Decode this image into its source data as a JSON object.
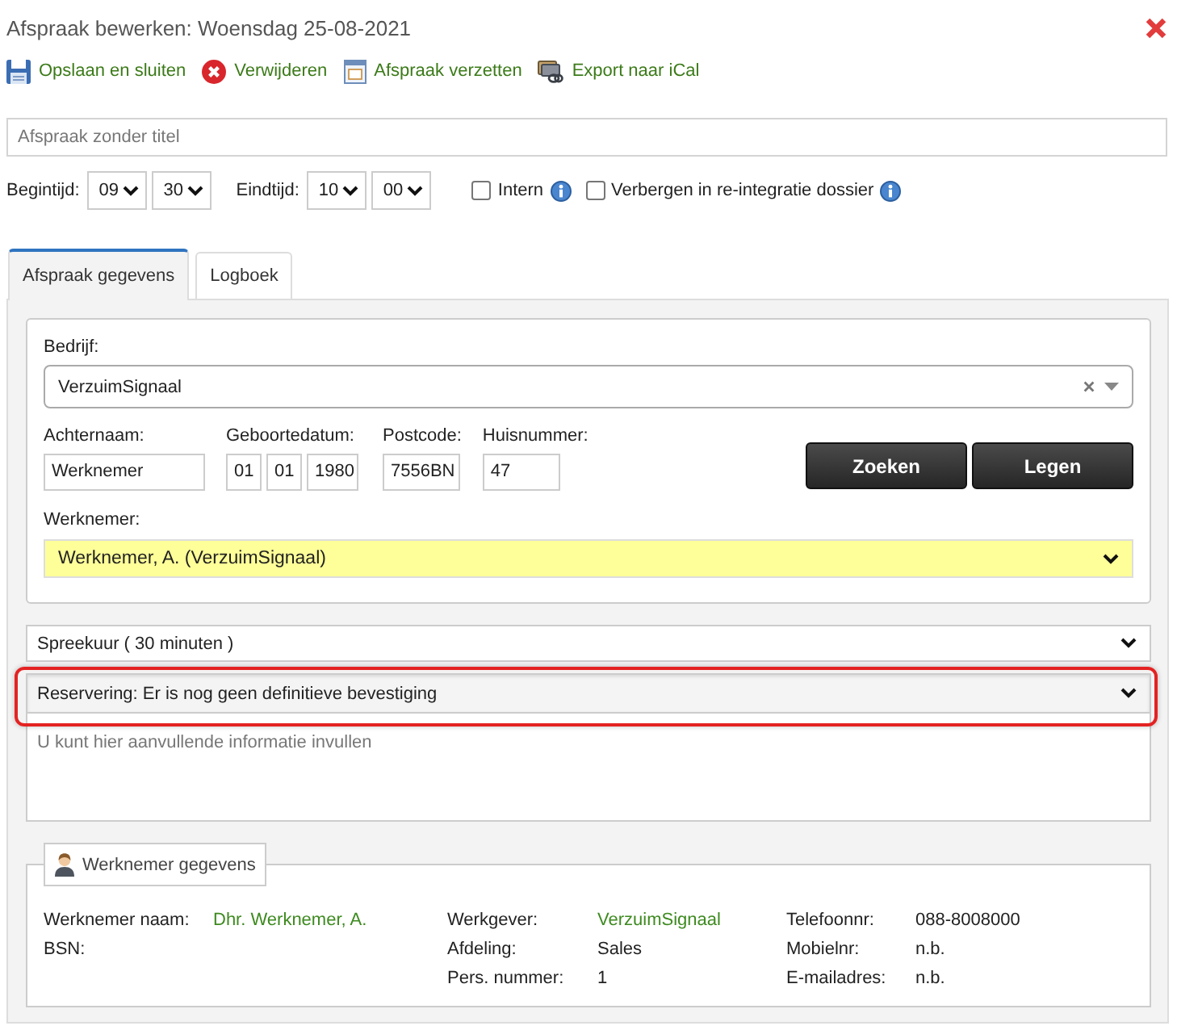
{
  "window": {
    "title": "Afspraak bewerken: Woensdag 25-08-2021"
  },
  "toolbar": [
    {
      "kind": "save",
      "label": "Opslaan en sluiten"
    },
    {
      "kind": "delete",
      "label": "Verwijderen"
    },
    {
      "kind": "reschedule",
      "label": "Afspraak verzetten"
    },
    {
      "kind": "export",
      "label": "Export naar iCal"
    }
  ],
  "title_field": {
    "placeholder": "Afspraak zonder titel"
  },
  "times": [
    {
      "label": "Begintijd:",
      "hour": "09",
      "minute": "30"
    },
    {
      "label": "Eindtijd:",
      "hour": "10",
      "minute": "00"
    }
  ],
  "checkboxes": [
    {
      "label": "Intern",
      "checked": false
    },
    {
      "label": "Verbergen in re-integratie dossier",
      "checked": false
    }
  ],
  "tabs": [
    {
      "label": "Afspraak gegevens",
      "selected": true
    },
    {
      "label": "Logboek",
      "selected": false
    }
  ],
  "search": {
    "company_label": "Bedrijf:",
    "company_value": "VerzuimSignaal",
    "fields": [
      {
        "label": "Achternaam:",
        "values": [
          "Werknemer"
        ]
      },
      {
        "label": "Geboortedatum:",
        "values": [
          "01",
          "01",
          "1980"
        ]
      },
      {
        "label": "Postcode:",
        "values": [
          "7556BN"
        ]
      },
      {
        "label": "Huisnummer:",
        "values": [
          "47"
        ]
      }
    ],
    "buttons": [
      "Zoeken",
      "Legen"
    ],
    "employee_label": "Werknemer:",
    "employee_value": "Werknemer, A. (VerzuimSignaal)"
  },
  "appointment_type": {
    "value": "Spreekuur ( 30 minuten )"
  },
  "status": {
    "value": "Reservering: Er is nog geen definitieve bevestiging",
    "highlighted": true
  },
  "notes": {
    "placeholder": "U kunt hier aanvullende informatie invullen"
  },
  "employee_details": {
    "legend": "Werknemer gegevens",
    "columns": [
      {
        "rows": [
          {
            "label": "Werknemer naam:",
            "value": "Dhr. Werknemer, A.",
            "kind": "link"
          },
          {
            "label": "BSN:"
          }
        ]
      },
      {
        "rows": [
          {
            "label": "Werkgever:",
            "value": "VerzuimSignaal",
            "kind": "link"
          },
          {
            "label": "Afdeling:",
            "value": "Sales",
            "kind": "text"
          },
          {
            "label": "Pers. nummer:",
            "value": "1",
            "kind": "text"
          }
        ]
      },
      {
        "rows": [
          {
            "label": "Telefoonnr:",
            "value": "088-8008000",
            "kind": "text"
          },
          {
            "label": "Mobielnr:",
            "value": "n.b.",
            "kind": "text"
          },
          {
            "label": "E-mailadres:",
            "value": "n.b.",
            "kind": "text"
          }
        ]
      }
    ]
  }
}
